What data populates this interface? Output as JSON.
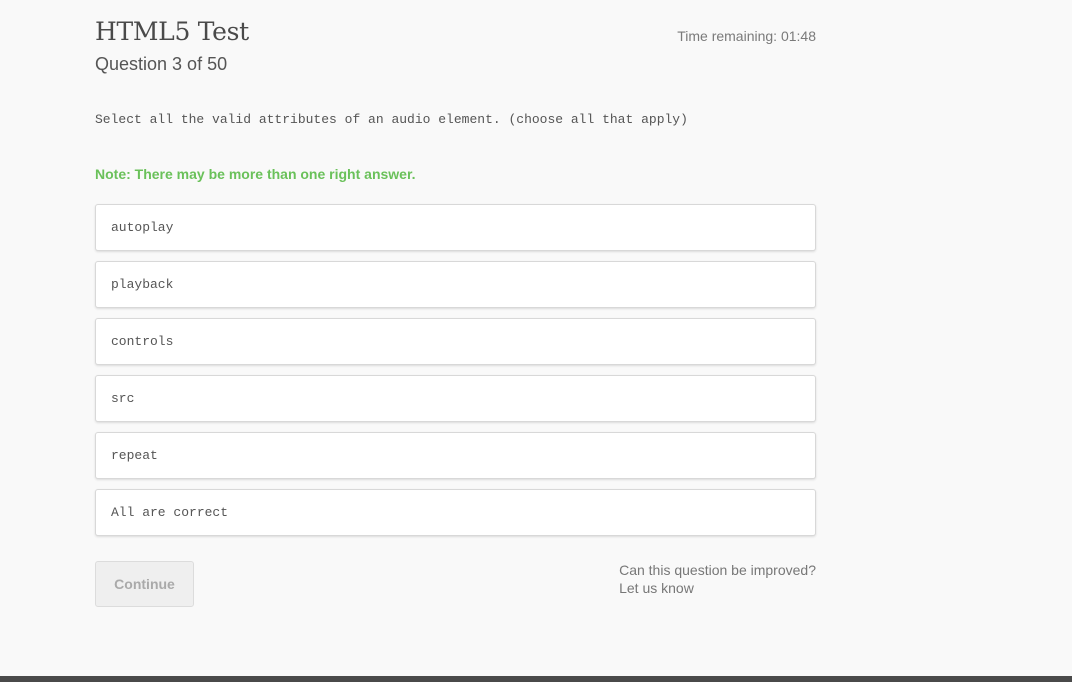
{
  "header": {
    "title": "HTML5 Test",
    "question_counter": "Question 3 of 50",
    "timer": "Time remaining: 01:48"
  },
  "question": {
    "text": "Select all the valid attributes of an audio element. (choose all that apply)",
    "note": "Note: There may be more than one right answer."
  },
  "answers": [
    {
      "label": "autoplay"
    },
    {
      "label": "playback"
    },
    {
      "label": "controls"
    },
    {
      "label": "src"
    },
    {
      "label": "repeat"
    },
    {
      "label": "All are correct"
    }
  ],
  "actions": {
    "continue_label": "Continue"
  },
  "feedback": {
    "question_text": "Can this question be improved?",
    "link_text": "Let us know"
  },
  "colors": {
    "note_green": "#6ac15a",
    "background": "#f9f9f9",
    "footer": "#4a4a4a"
  }
}
